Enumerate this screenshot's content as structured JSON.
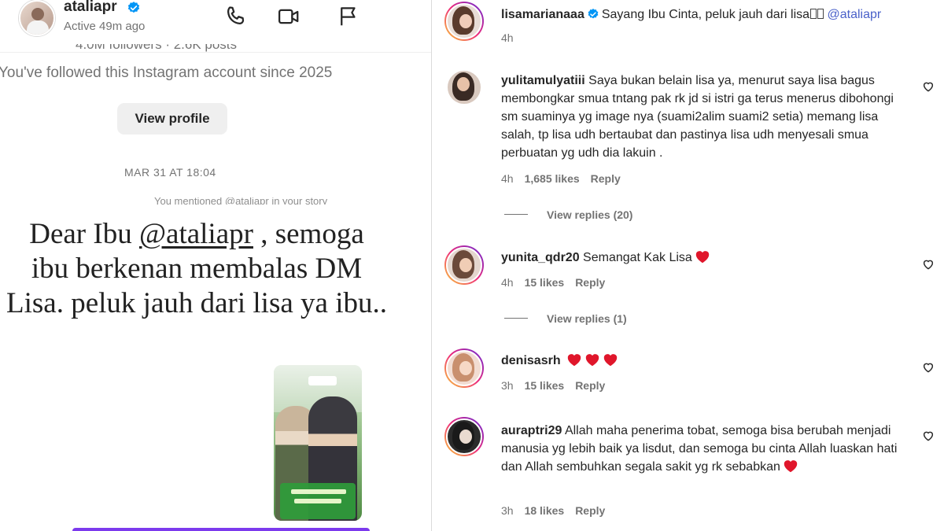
{
  "dm": {
    "header": {
      "username": "ataliapr",
      "status": "Active 49m ago",
      "icons": [
        "phone-icon",
        "video-icon",
        "flag-icon",
        "verified-icon"
      ]
    },
    "profile_info": {
      "followers": "4.0M followers · 2.6K posts",
      "followed_since": "You've followed this Instagram account since 2025",
      "view_profile_label": "View profile"
    },
    "timestamp": "MAR 31 AT 18:04",
    "mentioned_note": "You mentioned @ataliapr in your story",
    "story_caption": {
      "prefix": "Dear Ibu ",
      "mention": "@ataliapr",
      "rest_line1": " , semoga",
      "rest": "ibu berkenan membalas DM Lisa. peluk jauh dari lisa ya ibu.."
    }
  },
  "comments": {
    "caption": {
      "user": "lisamarianaaa",
      "text": "Sayang Ibu Cinta, peluk jauh dari lisa",
      "mention": "@ataliapr",
      "time": "4h"
    },
    "items": [
      {
        "user": "yulitamulyatiii",
        "text": "Saya bukan belain lisa ya, menurut saya lisa bagus membongkar smua tntang pak rk jd si istri ga terus menerus dibohongi sm suaminya yg image nya (suami2alim suami2 setia) memang lisa salah, tp lisa udh bertaubat dan pastinya lisa udh menyesali smua perbuatan yg udh dia lakuin .",
        "time": "4h",
        "likes": "1,685 likes",
        "reply": "Reply",
        "view_replies": "View replies (20)"
      },
      {
        "user": "yunita_qdr20",
        "text": "Semangat Kak Lisa",
        "hearts": 1,
        "time": "4h",
        "likes": "15 likes",
        "reply": "Reply",
        "view_replies": "View replies (1)"
      },
      {
        "user": "denisasrh",
        "text": "",
        "hearts": 3,
        "time": "3h",
        "likes": "15 likes",
        "reply": "Reply"
      },
      {
        "user": "auraptri29",
        "text": "Allah maha penerima tobat, semoga bisa berubah menjadi manusia yg lebih baik ya lisdut, dan semoga bu cinta Allah luaskan hati dan Allah sembuhkan segala sakit yg rk sebabkan",
        "hearts": 1,
        "time": "3h",
        "likes": "18 likes",
        "reply": "Reply"
      }
    ]
  },
  "colors": {
    "accent_purple": "#7c3aed",
    "verified_blue": "#0095f6",
    "heart_red": "#e0162b",
    "mention_blue": "#4a61c9"
  }
}
